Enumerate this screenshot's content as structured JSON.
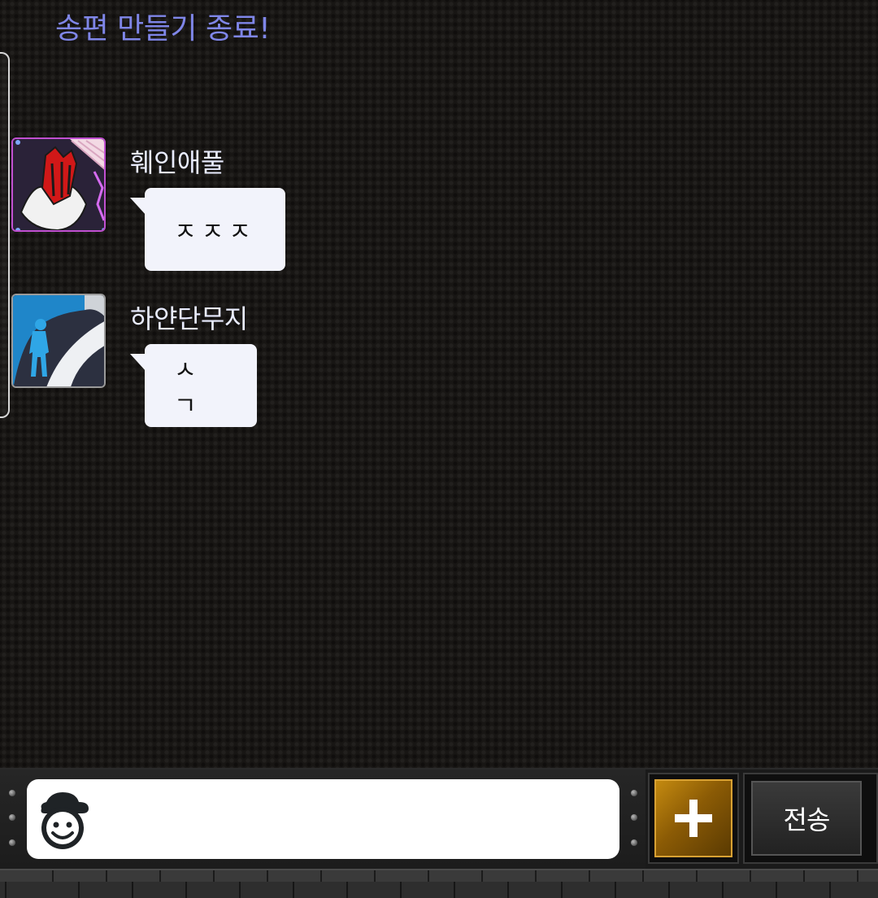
{
  "system_message": "송편 만들기 종료!",
  "messages": [
    {
      "sender": "훼인애풀",
      "text": "ㅈㅈㅈ",
      "avatar_icon": "red-hand-icon"
    },
    {
      "sender": "하얀단무지",
      "text": "ㅅㄱ",
      "avatar_icon": "walking-person-icon"
    }
  ],
  "input": {
    "value": "",
    "placeholder": "",
    "emoji_icon": "smiley-hat-icon"
  },
  "buttons": {
    "plus_icon": "plus-icon",
    "send_label": "전송"
  },
  "colors": {
    "system_text": "#7f86e8",
    "sender_text": "#e9ecff",
    "bubble": "#f2f3fb",
    "plus_button": "#b07a0c"
  }
}
